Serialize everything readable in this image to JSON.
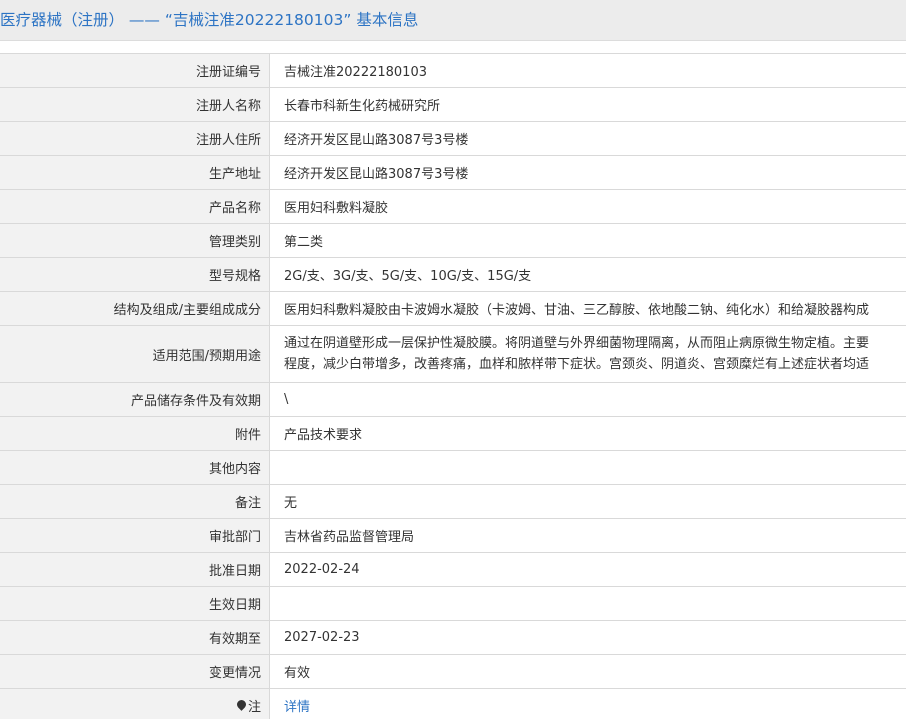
{
  "header": {
    "title": "医疗器械（注册） —— “吉械注准20222180103” 基本信息"
  },
  "rows": [
    {
      "label": "注册证编号",
      "value": "吉械注准20222180103"
    },
    {
      "label": "注册人名称",
      "value": "长春市科新生化药械研究所"
    },
    {
      "label": "注册人住所",
      "value": "经济开发区昆山路3087号3号楼"
    },
    {
      "label": "生产地址",
      "value": "经济开发区昆山路3087号3号楼"
    },
    {
      "label": "产品名称",
      "value": "医用妇科敷料凝胶"
    },
    {
      "label": "管理类别",
      "value": "第二类"
    },
    {
      "label": "型号规格",
      "value": "2G/支、3G/支、5G/支、10G/支、15G/支"
    },
    {
      "label": "结构及组成/主要组成成分",
      "value": "医用妇科敷料凝胶由卡波姆水凝胶（卡波姆、甘油、三乙醇胺、依地酸二钠、纯化水）和给凝胶器构成"
    },
    {
      "label": "适用范围/预期用途",
      "value_line1": "通过在阴道壁形成一层保护性凝胶膜。将阴道壁与外界细菌物理隔离，从而阻止病原微生物定植。主要",
      "value_line2": "程度，减少白带增多，改善疼痛，血样和脓样带下症状。宫颈炎、阴道炎、宫颈糜烂有上述症状者均适"
    },
    {
      "label": "产品储存条件及有效期",
      "value": "\\"
    },
    {
      "label": "附件",
      "value": "产品技术要求"
    },
    {
      "label": "其他内容",
      "value": ""
    },
    {
      "label": "备注",
      "value": "无"
    },
    {
      "label": "审批部门",
      "value": "吉林省药品监督管理局"
    },
    {
      "label": "批准日期",
      "value": "2022-02-24"
    },
    {
      "label": "生效日期",
      "value": ""
    },
    {
      "label": "有效期至",
      "value": "2027-02-23"
    },
    {
      "label": "变更情况",
      "value": "有效"
    },
    {
      "label": "注",
      "value": "详情"
    }
  ]
}
